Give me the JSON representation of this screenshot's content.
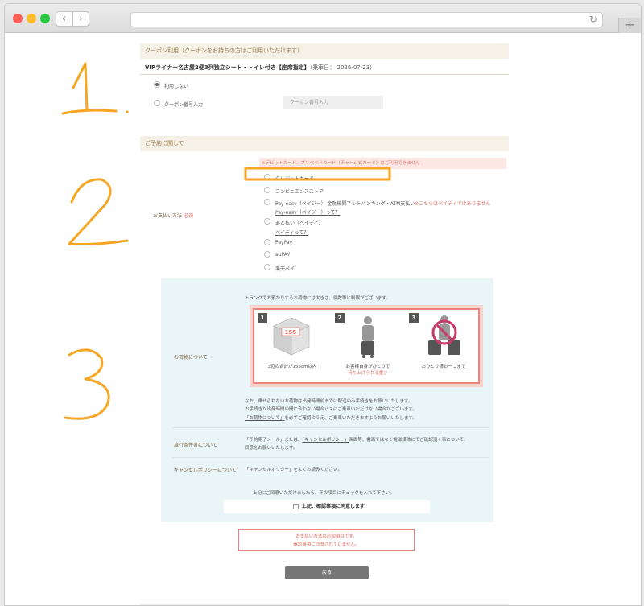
{
  "coupon_section": {
    "title": "クーポン利用（クーポンをお持ちの方はご利用いただけます）",
    "route_name": "VIPライナー名古屋2便3列独立シート・トイレ付き【座席指定】",
    "route_date": "（乗車日： 2026-07-23）",
    "options": [
      "利用しない",
      "クーポン番号入力"
    ],
    "coupon_placeholder": "クーポン番号入力"
  },
  "reservation_section": {
    "title": "ご予約に関して",
    "payment_label": "お支払い方法",
    "required_mark": "必須",
    "note": "※デビットカード、プリペイドカード（チャージ式カード）はご利用できません",
    "payment_options": [
      {
        "label": "クレジットカード"
      },
      {
        "label": "コンビニエンスストア"
      },
      {
        "label": "Pay-easy（ペイジー） 金融機関ネットバンキング・ATM支払い",
        "note": "※こちらはペイディではありません",
        "link": "Pay-easy（ペイジー）って？"
      },
      {
        "label": "あと払い（ペイディ）",
        "link": "ペイディって？"
      },
      {
        "label": "PayPay"
      },
      {
        "label": "auPAY"
      },
      {
        "label": "楽天ペイ"
      }
    ]
  },
  "info": {
    "luggage_label": "お荷物について",
    "luggage_intro": "トランクでお預かりするお荷物には大きさ、個数等に制限がございます。",
    "luggage_steps": [
      {
        "num": "1",
        "size": "155",
        "caption": "3辺の合計が155cm以内"
      },
      {
        "num": "2",
        "caption_line1": "お客様自身がひとりで",
        "caption_line2": "持ち上げられる重さ"
      },
      {
        "num": "3",
        "caption": "おひとり様お一つまで"
      }
    ],
    "luggage_warning_1": "なお、乗せられないお荷物は出発時間前までに配送のみ手続きをお願いいたします。",
    "luggage_warning_2": "お手続きが出発時間の間に合わない場合バスにご乗車いただけない場合がございます。",
    "luggage_link": "「お荷物について」",
    "luggage_tail": "を必ずご確認のうえ、ご乗車いただきますようお願いいたします。",
    "travel_label": "旅行条件書について",
    "travel_prefix": "「予約完了メール」または、",
    "travel_link": "「キャンセルポリシー」",
    "travel_suffix": "画面等、書面ではなく電磁媒体にてご確認頂く事について、",
    "travel_line2": "同意をお願いいたします。",
    "cancel_label": "キャンセルポリシーについて",
    "cancel_link": "「キャンセルポリシー」",
    "cancel_tail": "をよくお読みください。",
    "agree_intro": "上記にご同意いただけましたら、下の項目にチェックを入れて下さい。",
    "agree_text": "上記、確認事項に同意します"
  },
  "errors": {
    "line1": "お支払い方法は必須項目です。",
    "line2": "確認事項に同意されていません。"
  },
  "back_button": "戻る",
  "annotations": [
    "1",
    ".",
    "2",
    "3"
  ],
  "colors": {
    "accent": "#f5a623",
    "error": "#e06b5e"
  }
}
